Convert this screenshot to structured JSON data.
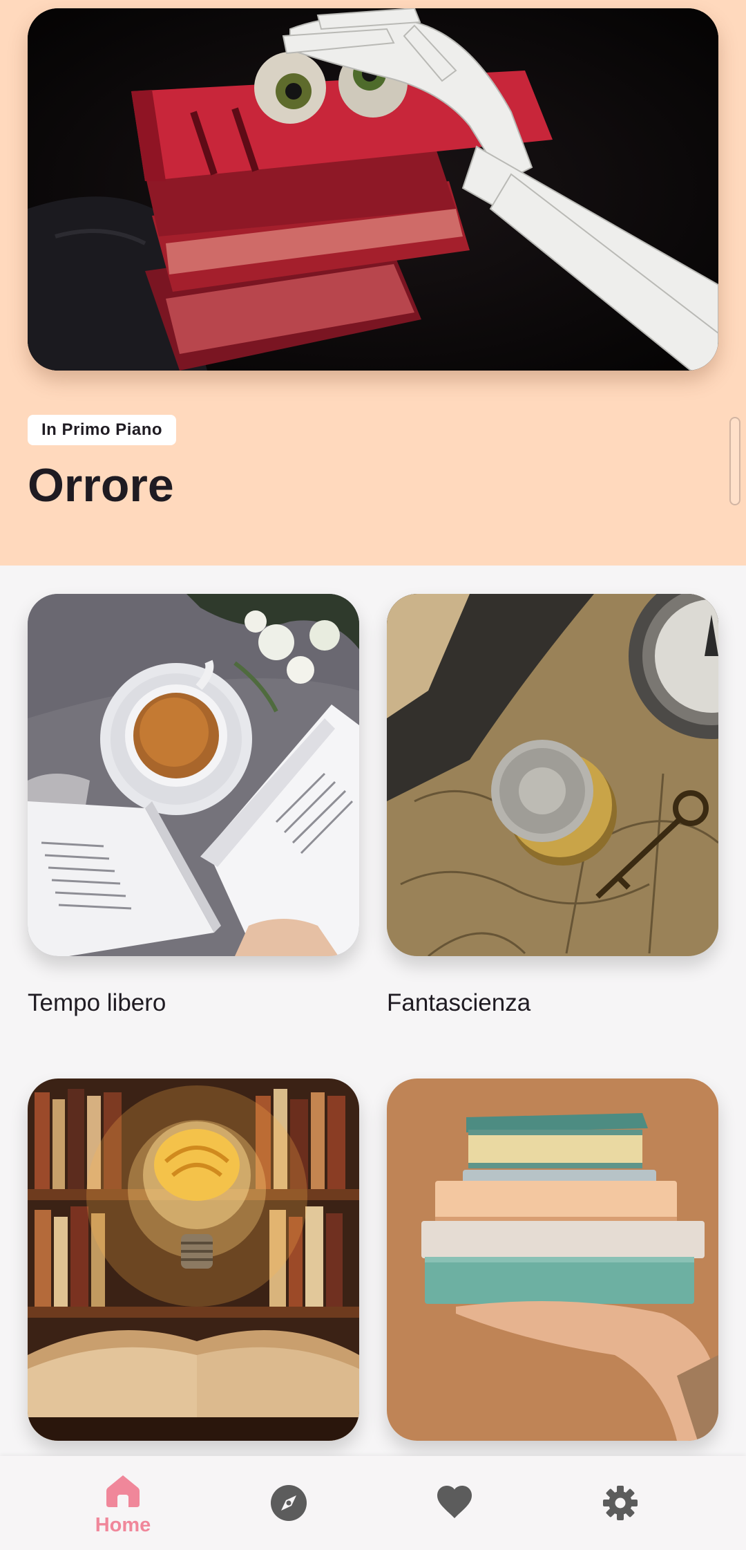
{
  "featured": {
    "badge": "In Primo Piano",
    "title": "Orrore"
  },
  "categories": [
    {
      "label": "Tempo libero"
    },
    {
      "label": "Fantascienza"
    },
    {
      "label": ""
    },
    {
      "label": ""
    }
  ],
  "bottom_nav": {
    "items": [
      {
        "label": "Home",
        "icon": "home-icon",
        "active": true
      },
      {
        "icon": "compass-icon"
      },
      {
        "icon": "heart-icon"
      },
      {
        "icon": "gear-icon"
      }
    ]
  },
  "colors": {
    "hero_background": "#ffd9bd",
    "accent_pink": "#f0879a",
    "nav_icon_gray": "#5c5c5c",
    "page_background": "#f6f5f6"
  }
}
